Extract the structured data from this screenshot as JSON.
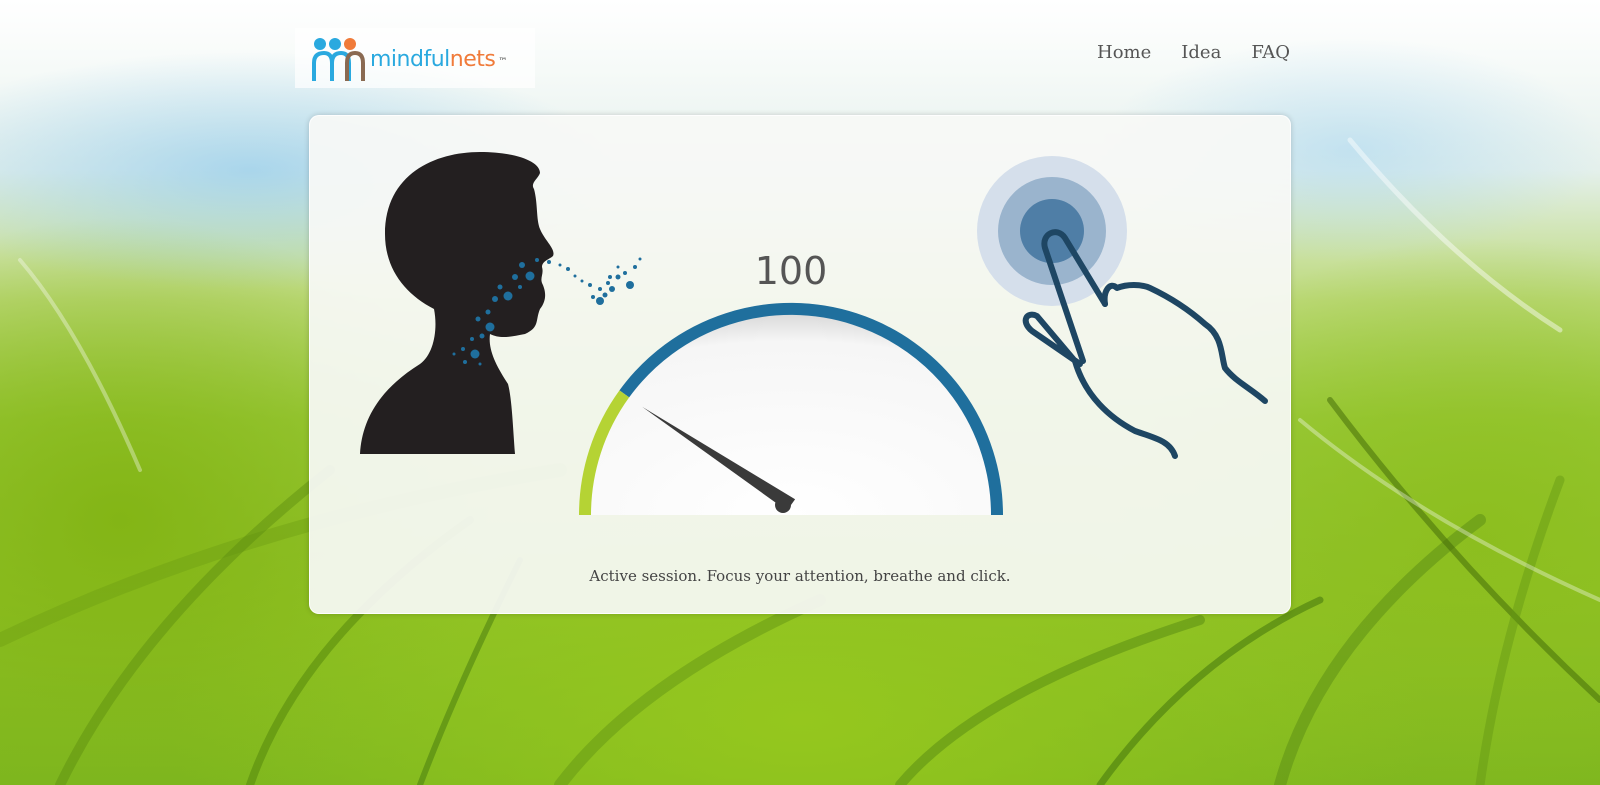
{
  "brand": {
    "name_part1": "mindful",
    "name_part2": "nets",
    "trademark": "™"
  },
  "nav": {
    "items": [
      {
        "label": "Home"
      },
      {
        "label": "Idea"
      },
      {
        "label": "FAQ"
      }
    ]
  },
  "session": {
    "score": "100",
    "status": "Active session. Focus your attention,  breathe and click."
  },
  "gauge": {
    "level_fraction": 0.2,
    "needle_fraction": 0.2,
    "colors": {
      "active": "#b5d334",
      "track": "#1f6f9d",
      "needle": "#3a3a3a"
    }
  },
  "icons": {
    "logo": "people-logo-icon",
    "head": "breathing-head-icon",
    "tap": "tap-hand-icon"
  }
}
